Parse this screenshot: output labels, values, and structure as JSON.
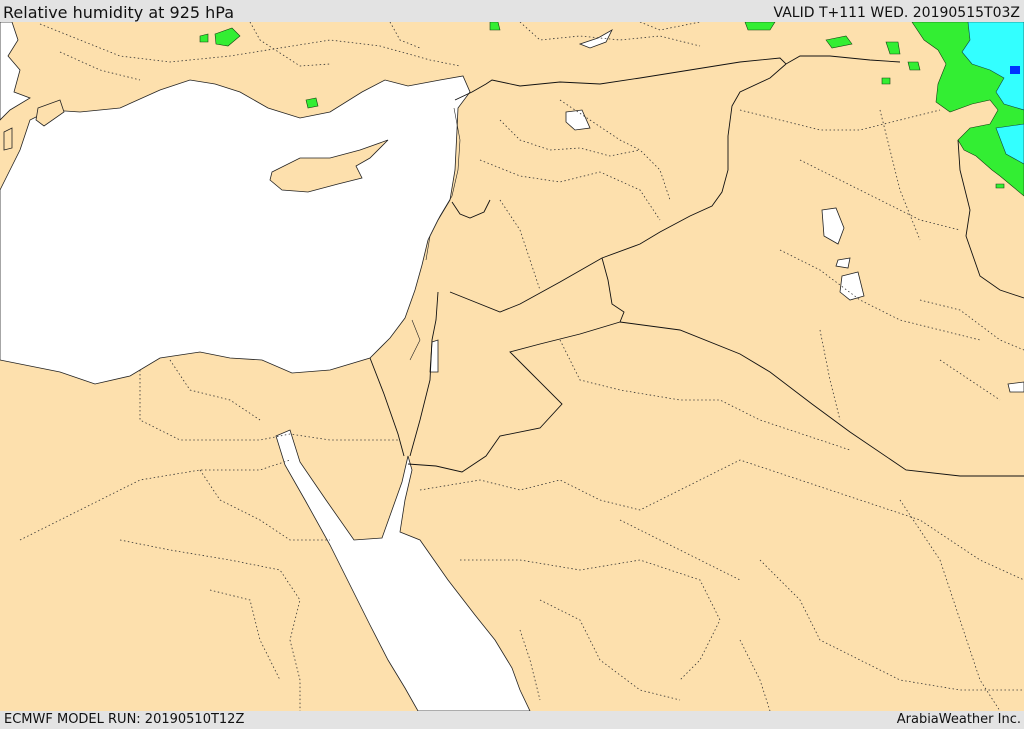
{
  "header": {
    "title": "Relative humidity at 925 hPa",
    "valid_time": "VALID T+111 WED. 20190515T03Z"
  },
  "footer": {
    "model_run": "ECMWF MODEL RUN: 20190510T12Z",
    "credit": "ArabiaWeather Inc."
  },
  "colors": {
    "land": "#fde0ad",
    "water": "#ffffff",
    "humidity_green": "#33ee33",
    "humidity_cyan": "#33ffff",
    "humidity_blue": "#0033ff",
    "border": "#111111"
  }
}
